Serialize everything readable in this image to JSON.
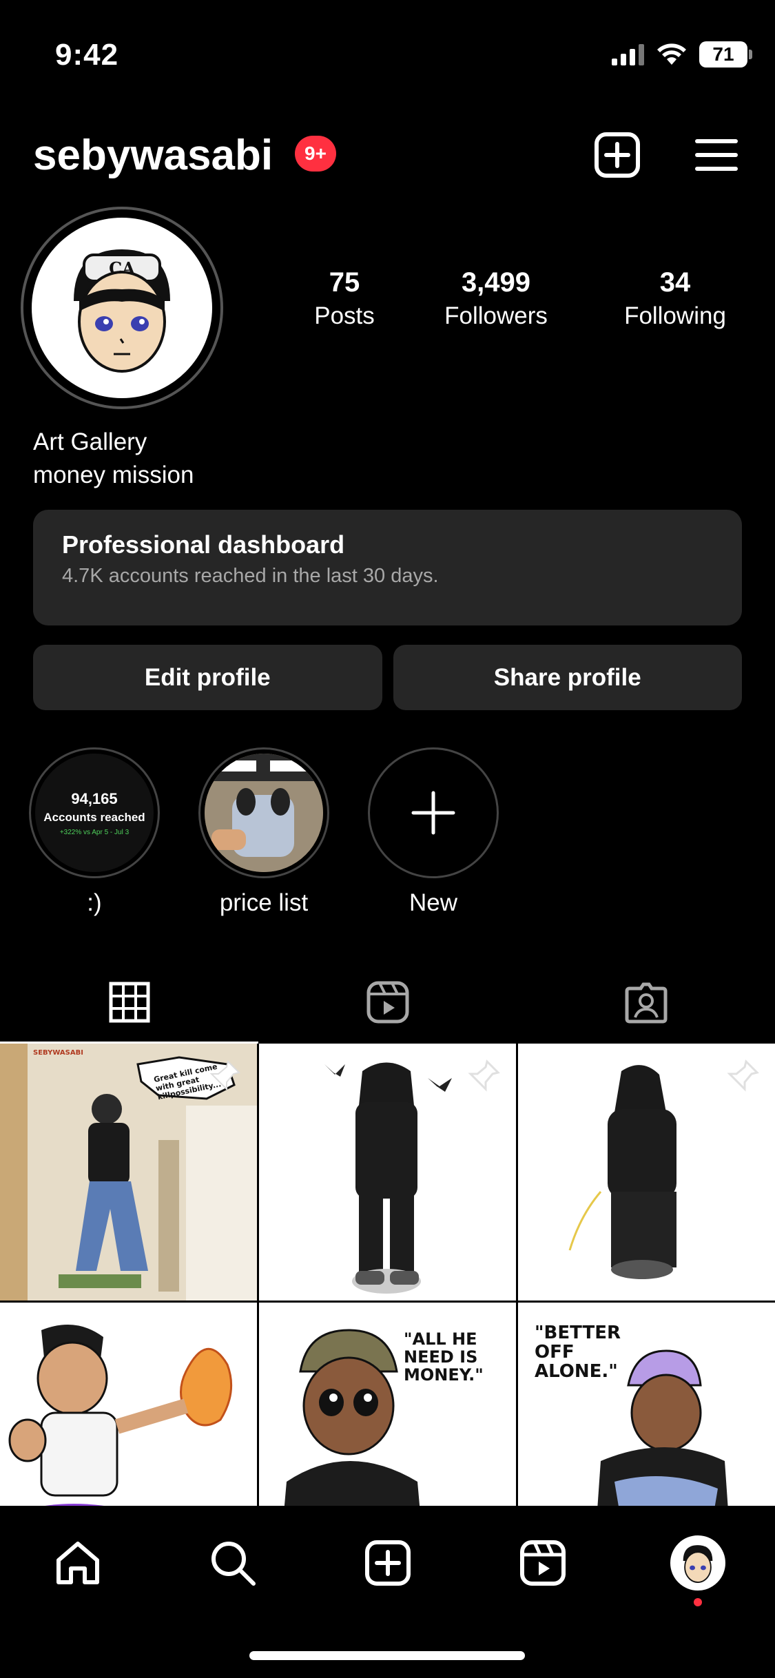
{
  "status_bar": {
    "time": "9:42",
    "battery": "71"
  },
  "header": {
    "username": "sebywasabi",
    "notification_badge": "9+"
  },
  "stats": [
    {
      "value": "75",
      "label": "Posts"
    },
    {
      "value": "3,499",
      "label": "Followers"
    },
    {
      "value": "34",
      "label": "Following"
    }
  ],
  "bio": {
    "line1": "Art Gallery",
    "line2": "money mission"
  },
  "dashboard": {
    "title": "Professional dashboard",
    "subtitle": "4.7K accounts reached in the last 30 days."
  },
  "actions": {
    "edit": "Edit profile",
    "share": "Share profile"
  },
  "highlights": [
    {
      "label": ":)",
      "cover_number": "94,165",
      "cover_text": "Accounts reached",
      "cover_small": "+322% vs Apr 5 - Jul 3"
    },
    {
      "label": "price list"
    },
    {
      "label": "New"
    }
  ],
  "posts": {
    "p1_caption": "Great kill come with great killpossibility...",
    "p1_tag": "SEBYWASABI",
    "p5_caption": "\"ALL HE NEED IS MONEY.\"",
    "p6_caption": "\"BETTER OFF ALONE.\""
  },
  "colors": {
    "badge": "#ff3040",
    "surface": "#262626",
    "background": "#000000"
  }
}
